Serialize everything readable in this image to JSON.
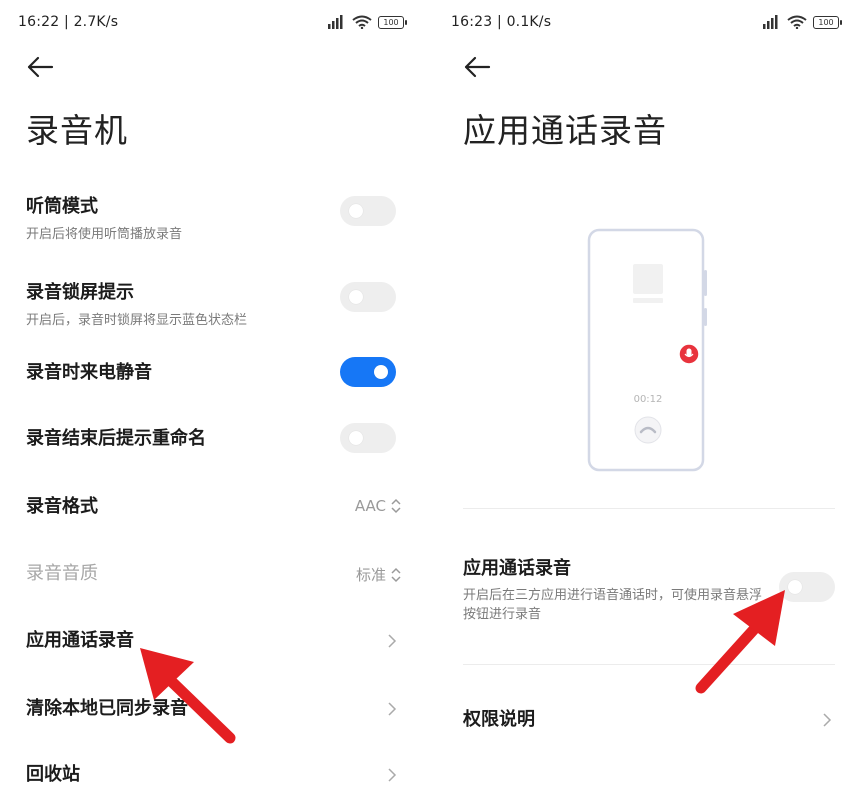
{
  "left": {
    "status": {
      "time": "16:22 | 2.7K/s",
      "battery": "100"
    },
    "title": "录音机",
    "items": [
      {
        "title": "听筒模式",
        "subtitle": "开启后将使用听筒播放录音",
        "toggle": false
      },
      {
        "title": "录音锁屏提示",
        "subtitle": "开启后，录音时锁屏将显示蓝色状态栏",
        "toggle": false
      },
      {
        "title": "录音时来电静音",
        "toggle": true
      },
      {
        "title": "录音结束后提示重命名",
        "toggle": false
      },
      {
        "title": "录音格式",
        "value": "AAC"
      },
      {
        "title": "录音音质",
        "value": "标准",
        "disabled": true
      },
      {
        "title": "应用通话录音"
      },
      {
        "title": "清除本地已同步录音"
      },
      {
        "title": "回收站"
      }
    ]
  },
  "right": {
    "status": {
      "time": "16:23 | 0.1K/s",
      "battery": "100"
    },
    "title": "应用通话录音",
    "phone_timer": "00:12",
    "setting": {
      "title": "应用通话录音",
      "description": "开启后在三方应用进行语音通话时，可使用录音悬浮按钮进行录音",
      "toggle": false
    },
    "permissions_label": "权限说明"
  },
  "colors": {
    "accent": "#1677f6",
    "record_red": "#e8333d",
    "arrow_red": "#e41f22"
  }
}
